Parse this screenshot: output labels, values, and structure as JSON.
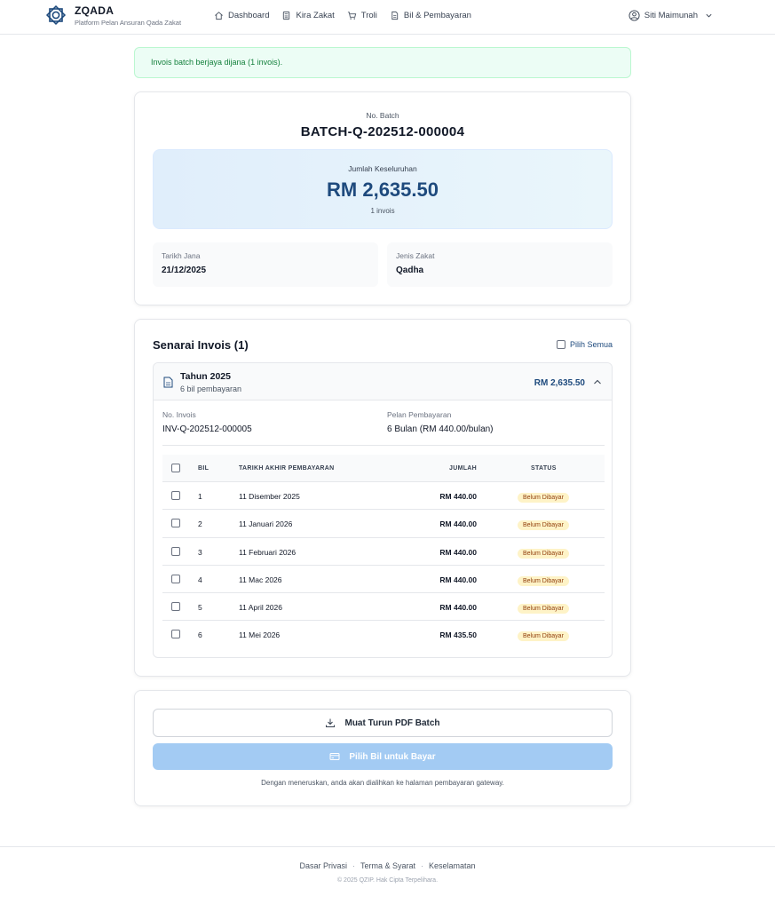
{
  "header": {
    "brand_name": "ZQADA",
    "brand_tagline": "Platform Pelan Ansuran Qada Zakat",
    "nav": [
      {
        "label": "Dashboard",
        "icon": "home-icon"
      },
      {
        "label": "Kira Zakat",
        "icon": "calculator-icon"
      },
      {
        "label": "Troli",
        "icon": "cart-icon"
      },
      {
        "label": "Bil & Pembayaran",
        "icon": "document-icon"
      }
    ],
    "user_name": "Siti Maimunah"
  },
  "alert": {
    "message": "Invois batch berjaya dijana (1 invois)."
  },
  "batch": {
    "label": "No. Batch",
    "number": "BATCH-Q-202512-000004",
    "total_label": "Jumlah Keseluruhan",
    "total_amount": "RM 2,635.50",
    "total_count": "1 invois",
    "date_label": "Tarikh Jana",
    "date_value": "21/12/2025",
    "type_label": "Jenis Zakat",
    "type_value": "Qadha"
  },
  "invoices": {
    "title": "Senarai Invois (1)",
    "select_all": "Pilih Semua",
    "group": {
      "title": "Tahun 2025",
      "subtitle": "6 bil pembayaran",
      "amount": "RM 2,635.50",
      "inv_label": "No. Invois",
      "inv_value": "INV-Q-202512-000005",
      "plan_label": "Pelan Pembayaran",
      "plan_value": "6 Bulan (RM 440.00/bulan)"
    },
    "columns": {
      "bil": "BIL",
      "date": "TARIKH AKHIR PEMBAYARAN",
      "amount": "JUMLAH",
      "status": "STATUS"
    },
    "rows": [
      {
        "bil": "1",
        "date": "11 Disember 2025",
        "amount": "RM 440.00",
        "status": "Belum Dibayar"
      },
      {
        "bil": "2",
        "date": "11 Januari 2026",
        "amount": "RM 440.00",
        "status": "Belum Dibayar"
      },
      {
        "bil": "3",
        "date": "11 Februari 2026",
        "amount": "RM 440.00",
        "status": "Belum Dibayar"
      },
      {
        "bil": "4",
        "date": "11 Mac 2026",
        "amount": "RM 440.00",
        "status": "Belum Dibayar"
      },
      {
        "bil": "5",
        "date": "11 April 2026",
        "amount": "RM 440.00",
        "status": "Belum Dibayar"
      },
      {
        "bil": "6",
        "date": "11 Mei 2026",
        "amount": "RM 435.50",
        "status": "Belum Dibayar"
      }
    ]
  },
  "actions": {
    "download_label": "Muat Turun PDF Batch",
    "pay_label": "Pilih Bil untuk Bayar",
    "note": "Dengan meneruskan, anda akan dialihkan ke halaman pembayaran gateway."
  },
  "footer": {
    "links": [
      "Dasar Privasi",
      "Terma & Syarat",
      "Keselamatan"
    ],
    "copyright": "© 2025 QZIP. Hak Cipta Terpelihara."
  },
  "colors": {
    "accent": "#1e4a7d",
    "success_bg": "#ecfdf5",
    "badge_bg": "#fef3c7",
    "pay_button": "#a3cbf3"
  }
}
